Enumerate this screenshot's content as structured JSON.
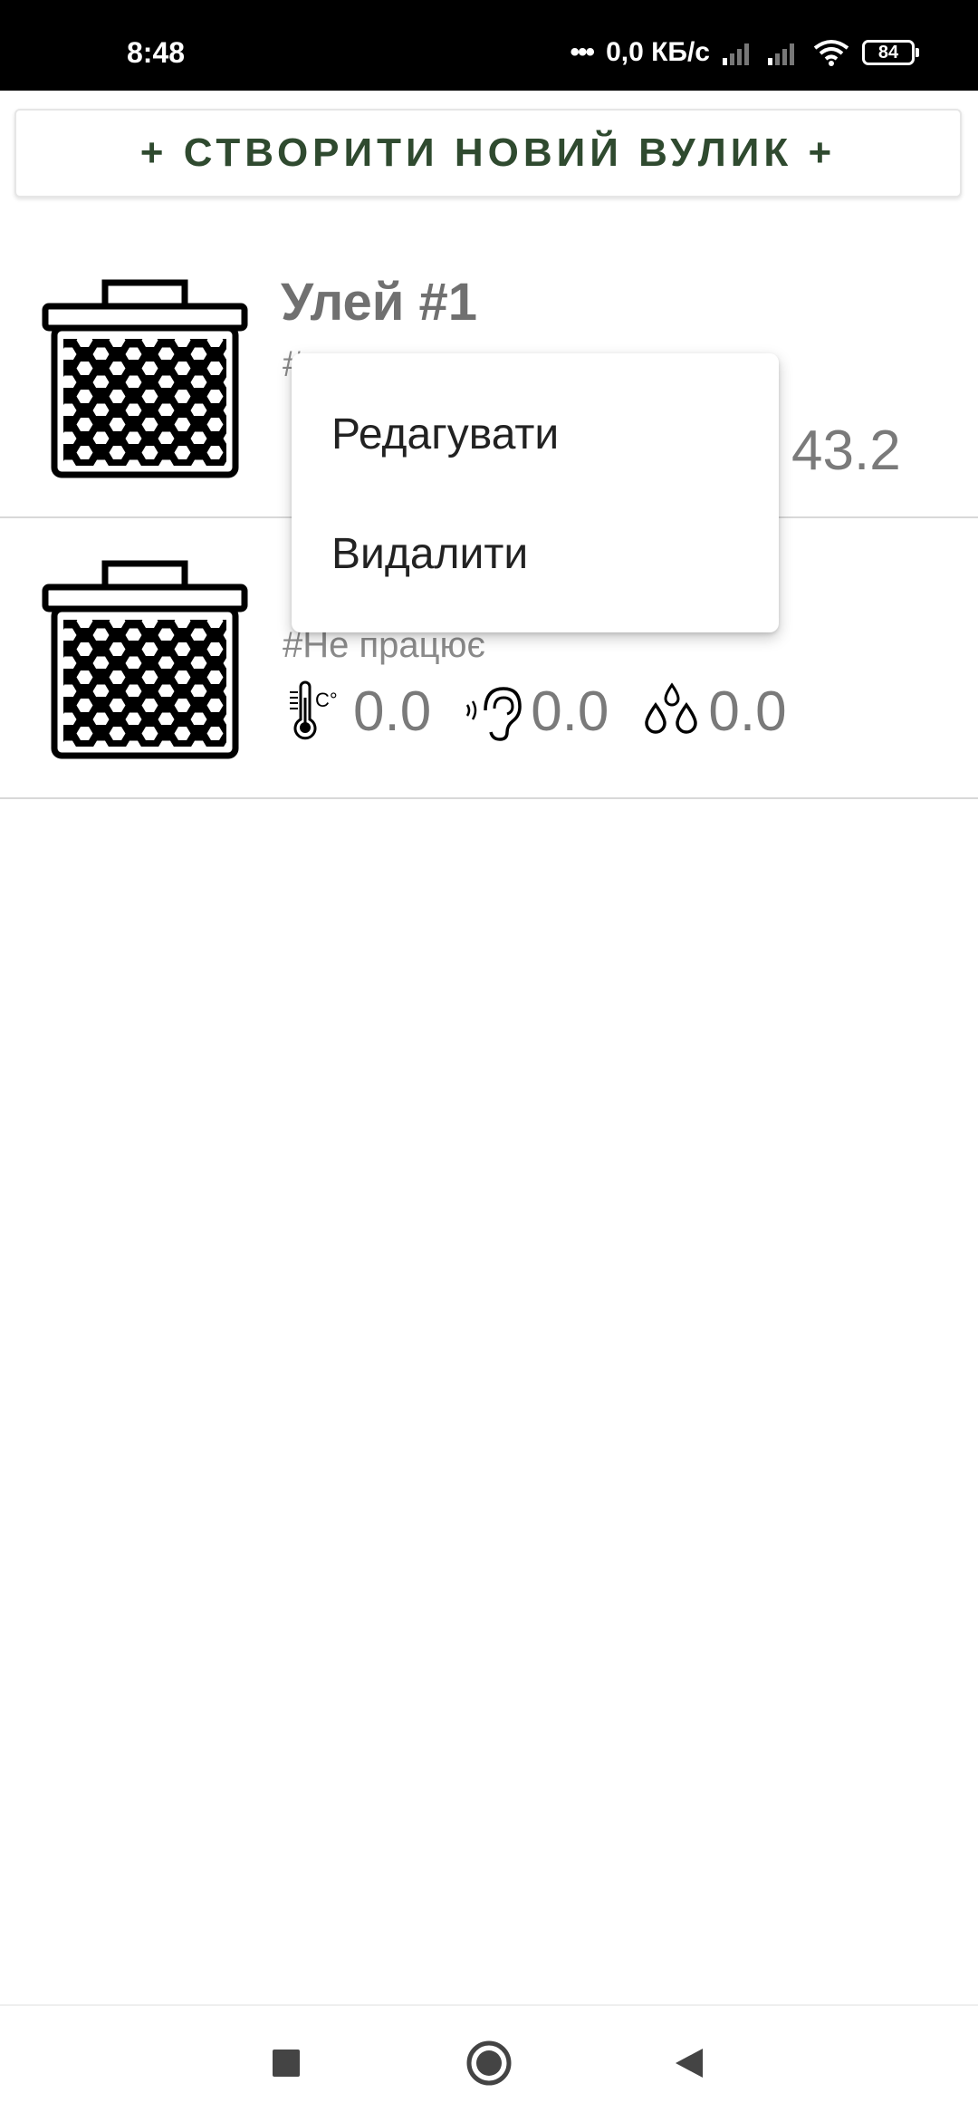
{
  "status_bar": {
    "time": "8:48",
    "speed": "0,0 КБ/с",
    "battery": "84"
  },
  "create_button": "+ СТВОРИТИ НОВИЙ ВУЛИК +",
  "hives": [
    {
      "name": "Улей #1",
      "status": "#",
      "metrics": {
        "humidity": "43.2"
      }
    },
    {
      "name": "",
      "status": "#Не працює",
      "metrics": {
        "temperature": "0.0",
        "sound": "0.0",
        "humidity": "0.0"
      }
    }
  ],
  "context_menu": {
    "items": [
      "Редагувати",
      "Видалити"
    ]
  },
  "icons": {
    "hive": "hive-icon",
    "temperature": "thermometer-icon",
    "sound": "ear-icon",
    "humidity": "drops-icon",
    "nav_recent": "square-icon",
    "nav_home": "circle-icon",
    "nav_back": "triangle-back-icon"
  },
  "colors": {
    "accent_text": "#2f4a2f",
    "name_gray": "#707070"
  }
}
